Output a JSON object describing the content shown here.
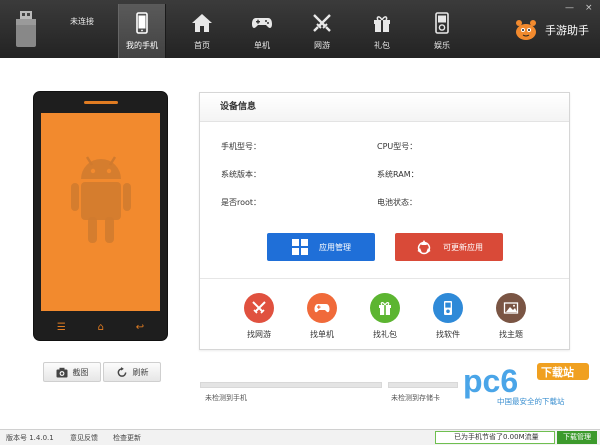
{
  "header": {
    "connection_status": "未连接",
    "nav": [
      {
        "label": "我的手机",
        "icon": "phone-icon",
        "active": true
      },
      {
        "label": "首页",
        "icon": "home-icon"
      },
      {
        "label": "单机",
        "icon": "gamepad-icon"
      },
      {
        "label": "网游",
        "icon": "swords-icon"
      },
      {
        "label": "礼包",
        "icon": "gift-icon"
      },
      {
        "label": "娱乐",
        "icon": "media-player-icon"
      }
    ],
    "brand": "手游助手",
    "window_controls": {
      "minimize": "—",
      "close": "×"
    }
  },
  "phone_tools": {
    "screenshot": "截图",
    "refresh": "刷新"
  },
  "device_info": {
    "title": "设备信息",
    "phone_model": "手机型号：",
    "cpu_model": "CPU型号：",
    "system_version": "系统版本：",
    "system_ram": "系统RAM：",
    "is_root": "是否root：",
    "battery": "电池状态：",
    "app_manage": "应用管理",
    "updatable_apps": "可更新应用",
    "find": [
      {
        "label": "找网游",
        "color": "#e0513f"
      },
      {
        "label": "找单机",
        "color": "#f06a3a"
      },
      {
        "label": "找礼包",
        "color": "#5cb531"
      },
      {
        "label": "找软件",
        "color": "#2f8ad8"
      },
      {
        "label": "找主题",
        "color": "#7a5544"
      }
    ]
  },
  "storage": {
    "phone": "未检测到手机",
    "sdcard": "未检测到存储卡"
  },
  "watermark": {
    "logo": "pc6",
    "badge": "下载站",
    "slogan": "中国最安全的下载站"
  },
  "statusbar": {
    "version": "版本号 1.4.0.1",
    "feedback": "意见反馈",
    "check_update": "检查更新",
    "traffic": "已为手机节省了0.00M流量",
    "traffic_button": "下载管理"
  }
}
